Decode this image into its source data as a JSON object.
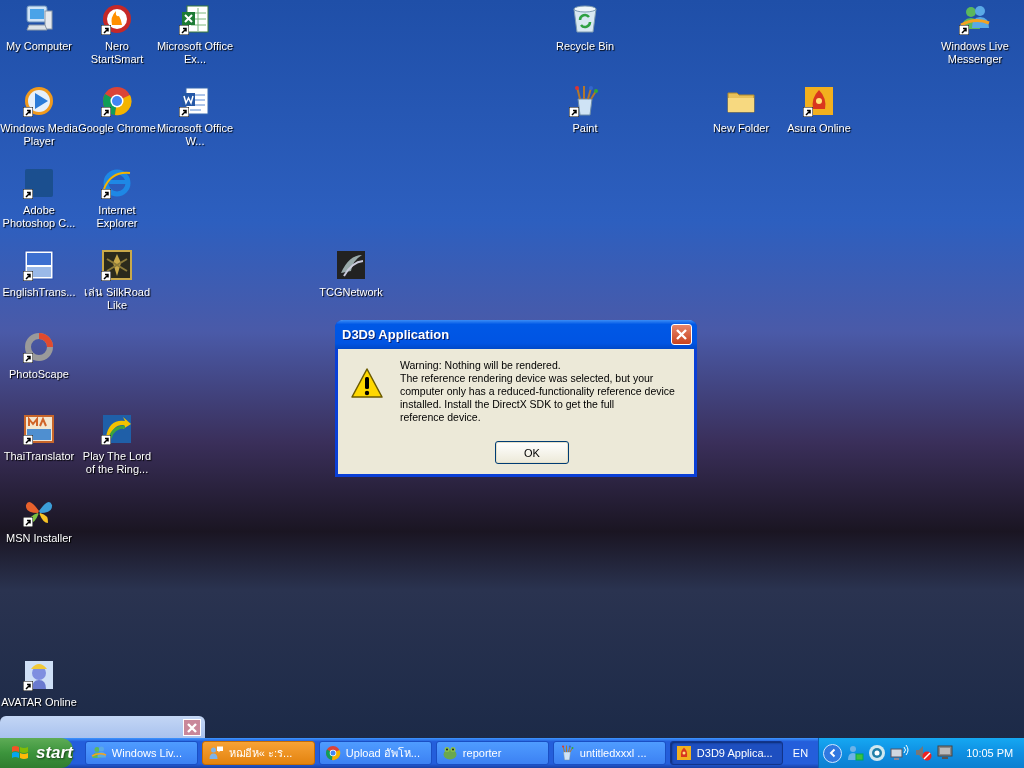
{
  "desktop_icons": [
    {
      "label": "My Computer",
      "kind": "computer",
      "shortcut": false
    },
    {
      "label": "Nero StartSmart",
      "kind": "flame",
      "shortcut": true
    },
    {
      "label": "Microsoft Office Ex...",
      "kind": "spreadsheet",
      "shortcut": true
    },
    {
      "label": "Recycle Bin",
      "kind": "bin",
      "shortcut": false
    },
    {
      "label": "Windows Live Messenger",
      "kind": "people",
      "shortcut": true
    },
    {
      "label": "Windows Media Player",
      "kind": "play",
      "shortcut": true
    },
    {
      "label": "Google Chrome",
      "kind": "chrome",
      "shortcut": true
    },
    {
      "label": "Microsoft Office W...",
      "kind": "document",
      "shortcut": true
    },
    {
      "label": "Paint",
      "kind": "paint",
      "shortcut": true
    },
    {
      "label": "New Folder",
      "kind": "folder",
      "shortcut": false
    },
    {
      "label": "Asura Online",
      "kind": "emblem",
      "shortcut": true
    },
    {
      "label": "Adobe Photoshop C...",
      "kind": "ps",
      "shortcut": true
    },
    {
      "label": "Internet Explorer",
      "kind": "ie",
      "shortcut": true
    },
    {
      "label": "EnglishTrans...",
      "kind": "abc",
      "shortcut": true
    },
    {
      "label": "เล่น SilkRoad Like",
      "kind": "warrior",
      "shortcut": true
    },
    {
      "label": "TCGNetwork",
      "kind": "claw",
      "shortcut": false
    },
    {
      "label": "PhotoScape",
      "kind": "ring",
      "shortcut": true
    },
    {
      "label": "ThaiTranslator",
      "kind": "translator",
      "shortcut": true
    },
    {
      "label": "Play The Lord of the Ring...",
      "kind": "arrow",
      "shortcut": true
    },
    {
      "label": "MSN Installer",
      "kind": "butterfly",
      "shortcut": true
    },
    {
      "label": "AVATAR Online",
      "kind": "character",
      "shortcut": true
    }
  ],
  "dialog": {
    "title": "D3D9 Application",
    "message": "Warning: Nothing will be rendered.\nThe reference rendering device was selected, but your\ncomputer only has a reduced-functionality reference device\ninstalled.  Install the DirectX SDK to get the full\nreference device.",
    "buttons": [
      "OK"
    ]
  },
  "taskbar": {
    "start_label": "start",
    "tasks": [
      {
        "label": "Windows Liv...",
        "kind": "people",
        "selected": false,
        "flashing": false
      },
      {
        "label": "หฌอีห« ะ:ร...",
        "kind": "chat",
        "selected": false,
        "flashing": true
      },
      {
        "label": "Upload อัพโห...",
        "kind": "chrome",
        "selected": false,
        "flashing": false
      },
      {
        "label": "reporter",
        "kind": "frog",
        "selected": false,
        "flashing": false
      },
      {
        "label": "untitledxxxl ...",
        "kind": "paint",
        "selected": false,
        "flashing": false
      },
      {
        "label": "D3D9 Applica...",
        "kind": "emblem",
        "selected": true,
        "flashing": false
      }
    ],
    "language": "EN",
    "clock": "10:05 PM"
  }
}
